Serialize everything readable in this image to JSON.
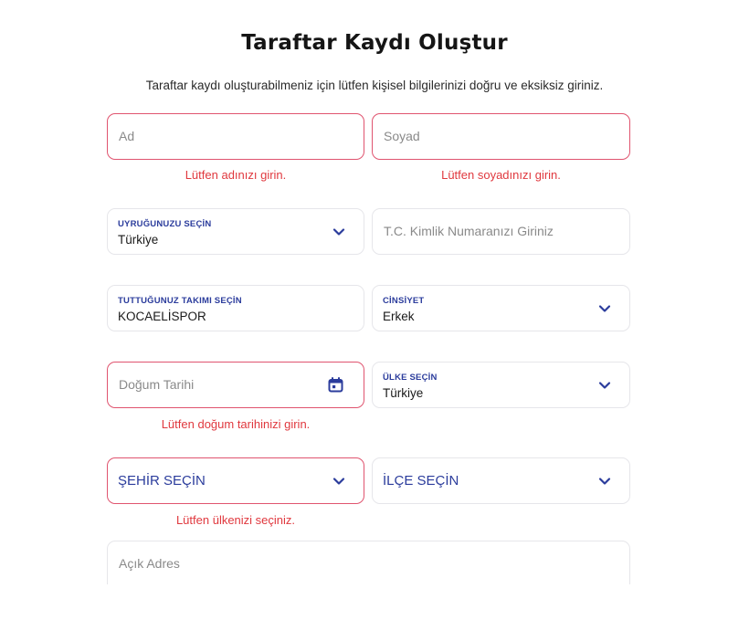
{
  "header": {
    "title": "Taraftar Kaydı Oluştur",
    "subtitle": "Taraftar kaydı oluşturabilmeniz için lütfen kişisel bilgilerinizi doğru ve eksiksiz giriniz."
  },
  "form": {
    "first_name": {
      "placeholder": "Ad",
      "error": "Lütfen adınızı girin."
    },
    "last_name": {
      "placeholder": "Soyad",
      "error": "Lütfen soyadınızı girin."
    },
    "nationality": {
      "label": "UYRUĞUNUZU SEÇİN",
      "value": "Türkiye"
    },
    "tc_id": {
      "placeholder": "T.C. Kimlik Numaranızı Giriniz"
    },
    "team": {
      "label": "TUTTUĞUNUZ TAKIMI SEÇİN",
      "value": "KOCAELİSPOR"
    },
    "gender": {
      "label": "CİNSİYET",
      "value": "Erkek"
    },
    "birth_date": {
      "placeholder": "Doğum Tarihi",
      "error": "Lütfen doğum tarihinizi girin."
    },
    "country": {
      "label": "ÜLKE SEÇİN",
      "value": "Türkiye"
    },
    "city": {
      "value": "ŞEHİR SEÇİN",
      "error": "Lütfen ülkenizi seçiniz."
    },
    "district": {
      "value": "İLÇE SEÇİN"
    },
    "address": {
      "placeholder": "Açık Adres"
    }
  },
  "colors": {
    "accent": "#2b3c9c",
    "error": "#e0383e",
    "error_border": "#e0546f"
  },
  "icons": {
    "dropdown": "chevron-down-icon",
    "date": "calendar-icon"
  }
}
